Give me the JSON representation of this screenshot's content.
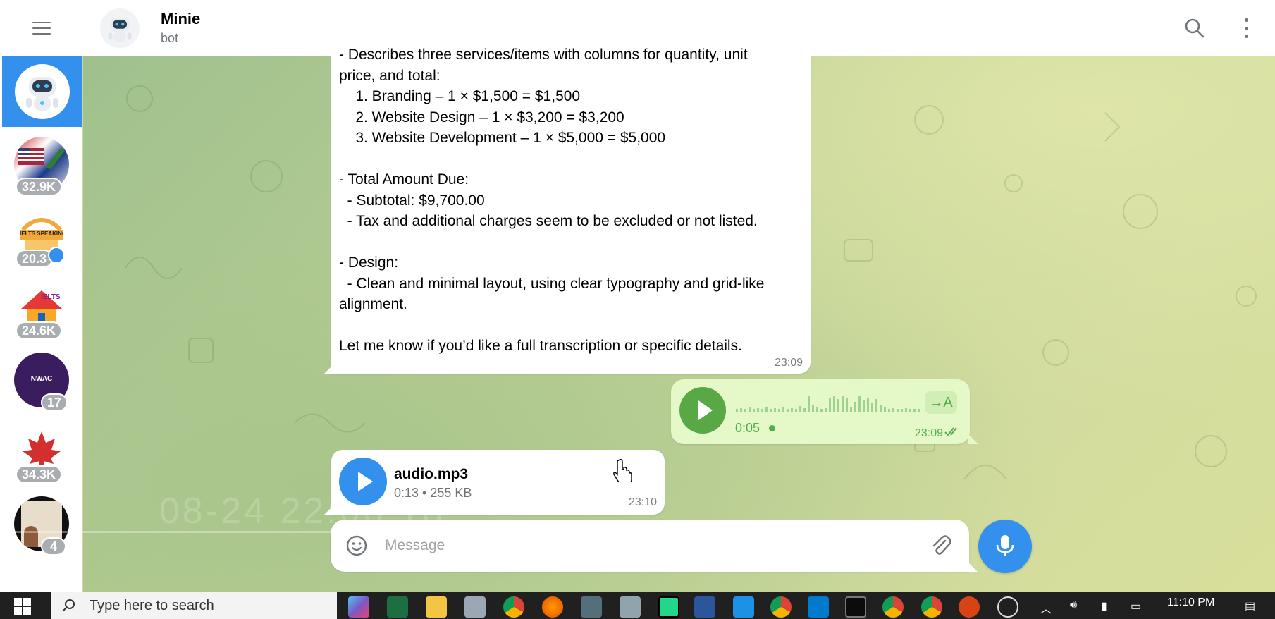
{
  "sidebar": {
    "items": [
      {
        "name": "Minie",
        "badge": ""
      },
      {
        "name": "chat-2",
        "badge": "32.9K"
      },
      {
        "name": "chat-3",
        "badge": "20.3",
        "logo_text": "IELTS SPEAKING"
      },
      {
        "name": "chat-4",
        "badge": "24.6K",
        "logo_text": "IELTS"
      },
      {
        "name": "chat-5",
        "badge": "17",
        "logo_text": "NWAC"
      },
      {
        "name": "chat-6",
        "badge": "34.3K"
      },
      {
        "name": "chat-7",
        "badge": "4"
      }
    ]
  },
  "header": {
    "title": "Minie",
    "subtitle": "bot"
  },
  "messages": {
    "text_message": {
      "lines": [
        "- Describes three services/items with columns for quantity, unit",
        "price, and total:",
        "    1. Branding – 1 × $1,500 = $1,500",
        "    2. Website Design – 1 × $3,200 = $3,200",
        "    3. Website Development – 1 × $5,000 = $5,000",
        "",
        "- Total Amount Due:",
        "  - Subtotal: $9,700.00",
        "  - Tax and additional charges seem to be excluded or not listed.",
        "",
        "- Design:",
        "  - Clean and minimal layout, using clear typography and grid-like",
        "alignment.",
        "",
        "Let me know if you’d like a full transcription or specific details."
      ],
      "time": "23:09"
    },
    "voice_message": {
      "duration": "0:05",
      "transcribe_label": "→A",
      "time": "23:09"
    },
    "audio_file": {
      "filename": "audio.mp3",
      "meta": "0:13 • 255 KB",
      "time": "23:10"
    }
  },
  "composer": {
    "placeholder": "Message"
  },
  "taskbar": {
    "search_placeholder": "Type here to search",
    "clock_time": "11:10 PM"
  },
  "colors": {
    "accent": "#3390ec",
    "outgoing_bubble": "#e4f8c8",
    "outgoing_text": "#4fae4e"
  }
}
